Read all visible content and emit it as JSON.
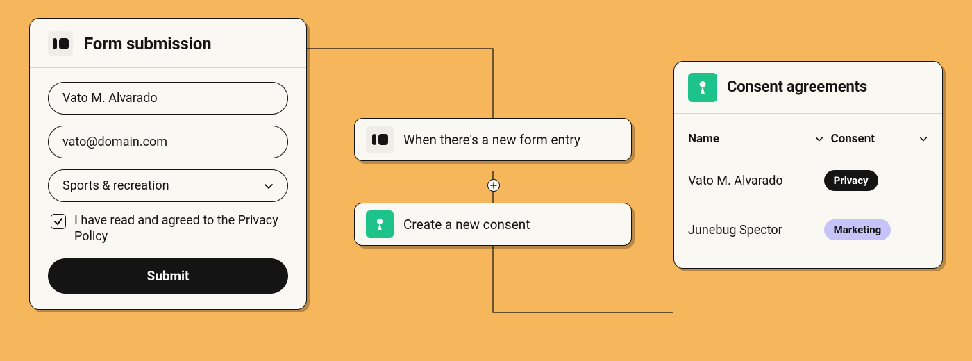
{
  "form_panel": {
    "title": "Form submission",
    "name_value": "Vato M. Alvarado",
    "email_value": "vato@domain.com",
    "topic_selected": "Sports & recreation",
    "consent_checkbox_label": "I have read and agreed to the Privacy Policy",
    "consent_checked": true,
    "submit_label": "Submit"
  },
  "automation": {
    "trigger_label": "When there's a new form entry",
    "action_label": "Create a new consent"
  },
  "consent_panel": {
    "title": "Consent agreements",
    "columns": {
      "name": "Name",
      "consent": "Consent"
    },
    "rows": [
      {
        "name": "Vato M. Alvarado",
        "consent": {
          "label": "Privacy",
          "variant": "dark"
        }
      },
      {
        "name": "Junebug Spector",
        "consent": {
          "label": "Marketing",
          "variant": "lav"
        }
      }
    ]
  },
  "icons": {
    "brand": "brand-icon",
    "keyhole": "keyhole-icon",
    "chevron_down": "chevron-down-icon",
    "check": "check-icon",
    "plus": "plus-icon"
  }
}
